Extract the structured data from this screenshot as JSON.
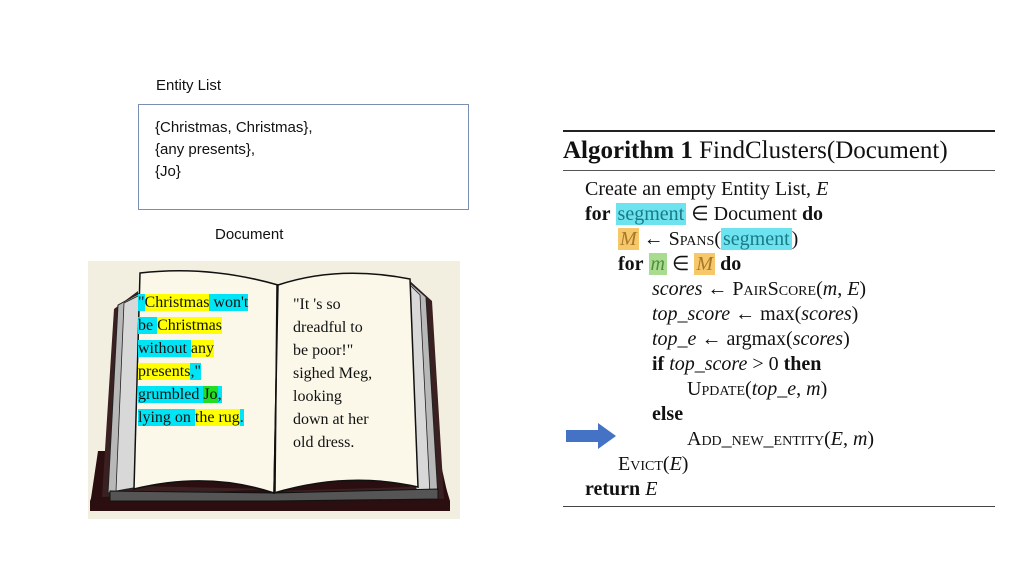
{
  "entity_list": {
    "label": "Entity List",
    "lines": [
      "{Christmas, Christmas},",
      "{any presents},",
      "{Jo}"
    ]
  },
  "document": {
    "label": "Document",
    "left_page": [
      [
        {
          "t": "\"",
          "h": "c"
        },
        {
          "t": "Christmas",
          "h": "y"
        },
        {
          "t": " won't",
          "h": "c"
        }
      ],
      [
        {
          "t": "be ",
          "h": "c"
        },
        {
          "t": "Christmas",
          "h": "y"
        }
      ],
      [
        {
          "t": "without ",
          "h": "c"
        },
        {
          "t": "any",
          "h": "y"
        }
      ],
      [
        {
          "t": "presents",
          "h": "y"
        },
        {
          "t": ",\"",
          "h": "c"
        }
      ],
      [
        {
          "t": "grumbled ",
          "h": "c"
        },
        {
          "t": "Jo",
          "h": "g"
        },
        {
          "t": ",",
          "h": "c"
        }
      ],
      [
        {
          "t": "lying on ",
          "h": "c"
        },
        {
          "t": "the rug",
          "h": "y"
        },
        {
          "t": ".",
          "h": "c"
        }
      ]
    ],
    "right_page": [
      "\"It 's so",
      "dreadful to",
      "be poor!\"",
      "sighed Meg,",
      "looking",
      "down at her",
      "old dress."
    ]
  },
  "algorithm": {
    "title_bold": "Algorithm 1",
    "title_rest": "FindClusters(Document)",
    "lines": {
      "l1_text": "Create an empty Entity List, ",
      "l1_var": "E",
      "for": "for",
      "do": "do",
      "segment": "segment",
      "in": "∈",
      "document": "Document",
      "M": "M",
      "larrow": "←",
      "spans": "Spans",
      "m": "m",
      "scores": "scores",
      "pairscore": "PairScore",
      "pairscore_args_open": "(",
      "comma_E_close": ", E)",
      "top_score": "top_score",
      "max": "max",
      "top_e": "top_e",
      "argmax": "argmax",
      "if": "if",
      "gt0": " > 0 ",
      "then": "then",
      "update": "Update",
      "else": "else",
      "add_new_entity": "Add_new_entity",
      "evict": "Evict",
      "return": "return",
      "E": "E"
    }
  },
  "colors": {
    "highlight_cyan": "#00e5f5",
    "highlight_yellow": "#ffff00",
    "highlight_green": "#22dd22",
    "algo_cyan": "#6de3ef",
    "algo_orange": "#f6c86a",
    "algo_green": "#a9dc90",
    "arrow_blue": "#4472c4"
  }
}
